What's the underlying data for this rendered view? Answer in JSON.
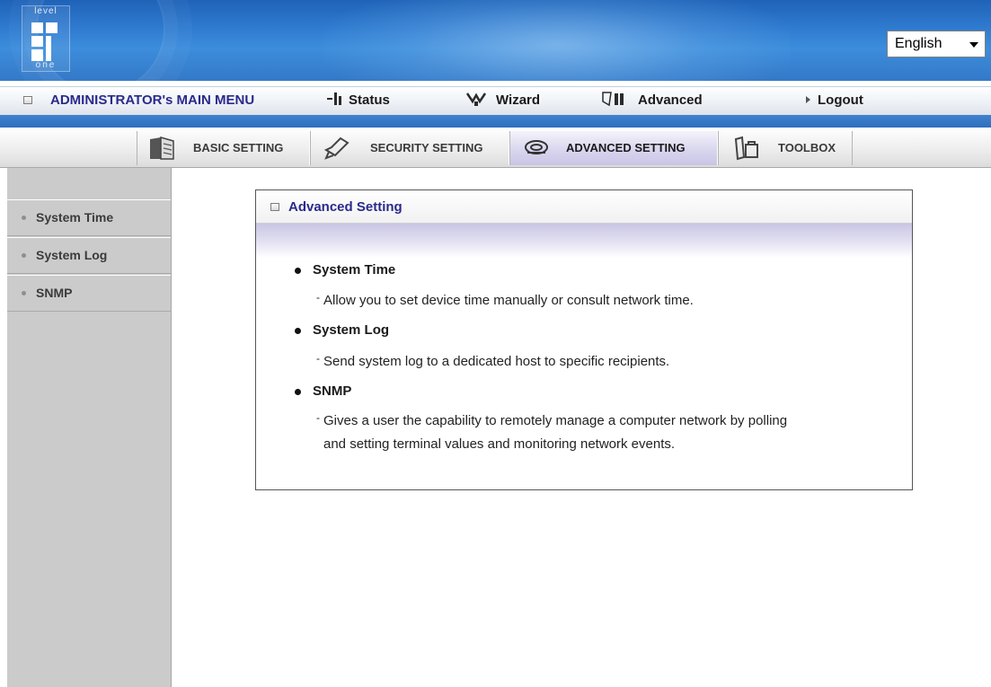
{
  "header": {
    "logo_top": "level",
    "logo_bottom": "one",
    "language": "English"
  },
  "main_menu": {
    "admin": "ADMINISTRATOR's MAIN MENU",
    "status": "Status",
    "wizard": "Wizard",
    "advanced": "Advanced",
    "logout": "Logout"
  },
  "tabs": [
    {
      "label": "BASIC SETTING",
      "icon": "folder-icon"
    },
    {
      "label": "SECURITY SETTING",
      "icon": "security-icon"
    },
    {
      "label": "ADVANCED SETTING",
      "icon": "advanced-icon",
      "active": true
    },
    {
      "label": "TOOLBOX",
      "icon": "toolbox-icon"
    }
  ],
  "sidebar": {
    "items": [
      {
        "label": "System Time"
      },
      {
        "label": "System Log"
      },
      {
        "label": "SNMP"
      }
    ]
  },
  "panel": {
    "title": "Advanced Setting",
    "items": [
      {
        "title": "System Time",
        "desc": "Allow you to set device time manually or consult network time."
      },
      {
        "title": "System Log",
        "desc": "Send system log to a dedicated host to specific recipients."
      },
      {
        "title": "SNMP",
        "desc_lines": [
          "Gives a user the capability to remotely manage a computer network by polling",
          "and setting terminal values and monitoring network events."
        ]
      }
    ]
  },
  "colors": {
    "header_blue": "#2f7bd0",
    "menu_text": "#2a2a8c",
    "sidebar_gray": "#cbcbcb",
    "active_tab": "#d9d6ee"
  }
}
